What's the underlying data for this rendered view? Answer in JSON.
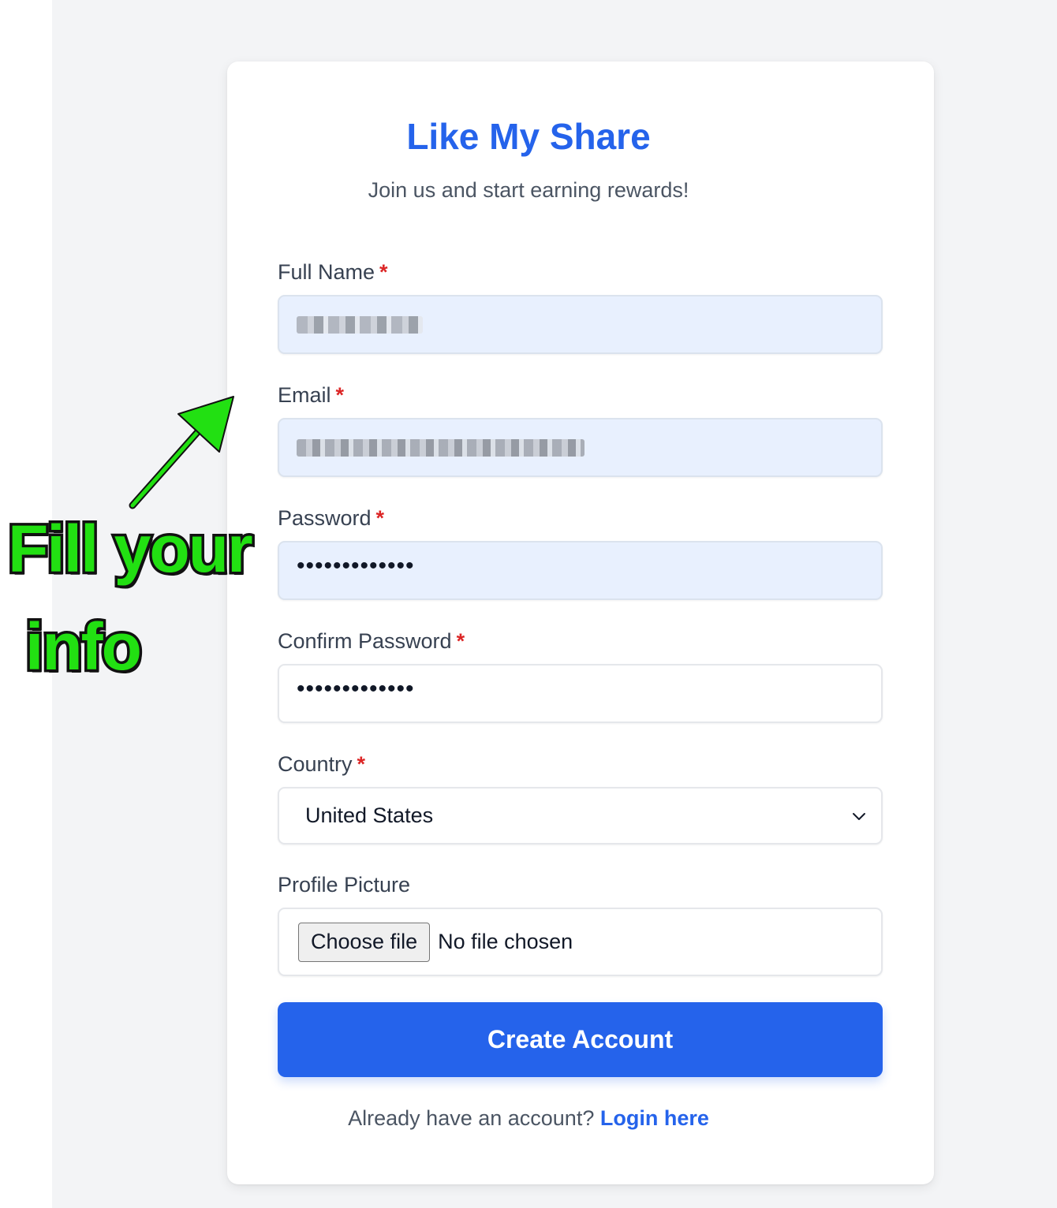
{
  "header": {
    "title": "Like My Share",
    "subtitle": "Join us and start earning rewards!"
  },
  "form": {
    "full_name": {
      "label": "Full Name",
      "required_mark": "*"
    },
    "email": {
      "label": "Email",
      "required_mark": "*"
    },
    "password": {
      "label": "Password",
      "required_mark": "*",
      "masked_value": "•••••••••••••"
    },
    "confirm_password": {
      "label": "Confirm Password",
      "required_mark": "*",
      "masked_value": "•••••••••••••"
    },
    "country": {
      "label": "Country",
      "required_mark": "*",
      "selected": "United States"
    },
    "profile_picture": {
      "label": "Profile Picture",
      "button_label": "Choose file",
      "status": "No file chosen"
    },
    "submit_label": "Create Account"
  },
  "footer": {
    "prompt": "Already have an account?",
    "link_label": "Login here"
  },
  "annotation": {
    "line1": "Fill your",
    "line2": "info",
    "color": "#22e012"
  },
  "colors": {
    "accent": "#2563eb",
    "required": "#dc2626",
    "autofill_bg": "#e8f0fe"
  }
}
